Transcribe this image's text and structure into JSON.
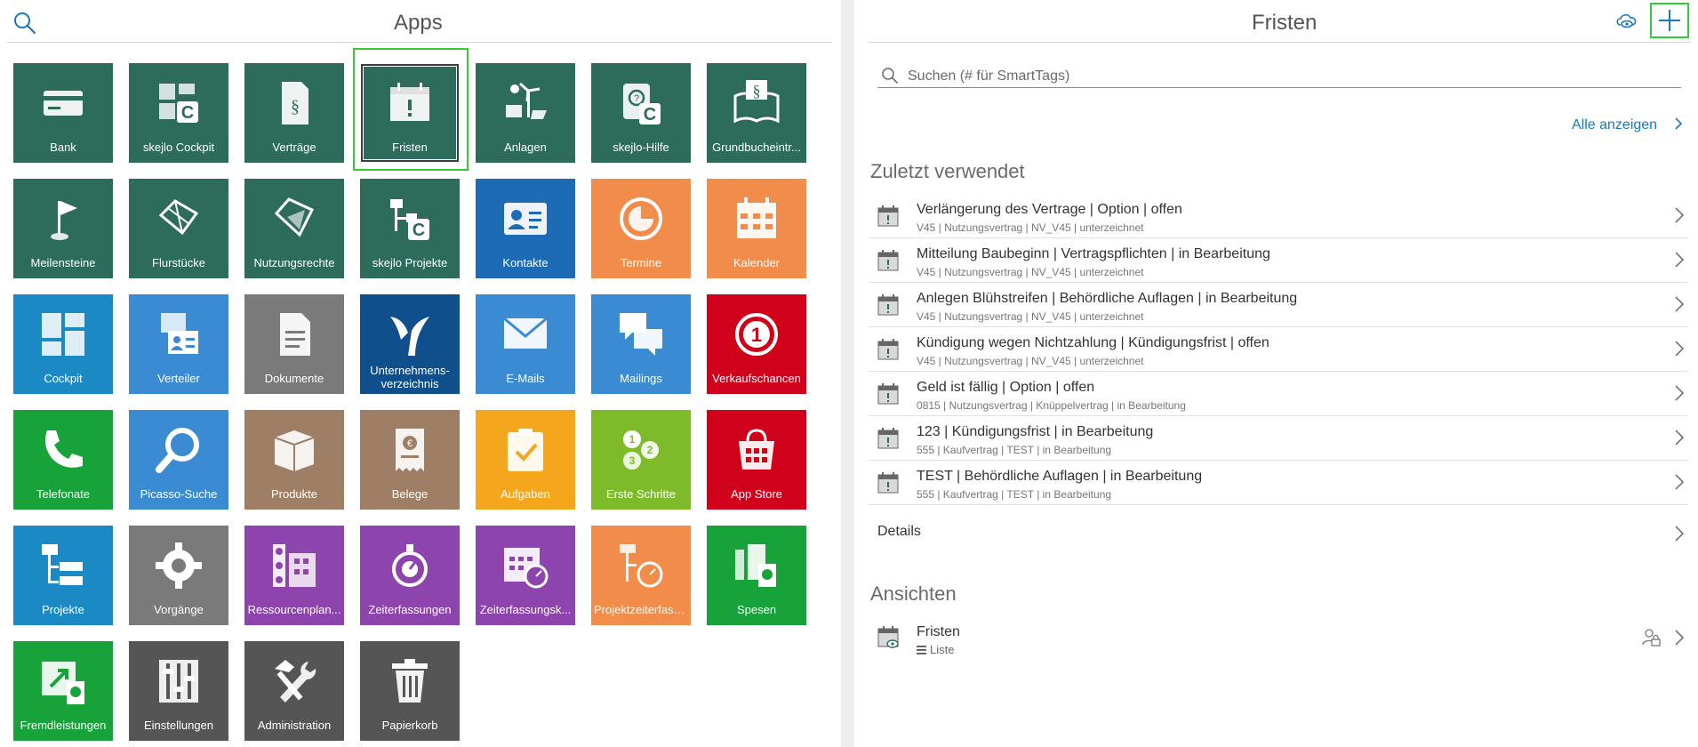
{
  "left_panel": {
    "title": "Apps",
    "search_icon": "search-icon",
    "tiles": [
      {
        "label": "Bank",
        "color": "#2d6b5a",
        "icon": "bank-card-icon"
      },
      {
        "label": "skejlo Cockpit",
        "color": "#2d6b5a",
        "icon": "cockpit-c-icon"
      },
      {
        "label": "Verträge",
        "color": "#2d6b5a",
        "icon": "contract-icon"
      },
      {
        "label": "Fristen",
        "color": "#2d6b5a",
        "icon": "calendar-alert-icon",
        "selected": true
      },
      {
        "label": "Anlagen",
        "color": "#2d6b5a",
        "icon": "power-plant-icon"
      },
      {
        "label": "skejlo-Hilfe",
        "color": "#2d6b5a",
        "icon": "help-book-icon"
      },
      {
        "label": "Grundbucheintr...",
        "color": "#2d6b5a",
        "icon": "law-book-icon"
      },
      {
        "label": "Meilensteine",
        "color": "#2d6b5a",
        "icon": "milestone-flag-icon"
      },
      {
        "label": "Flurstücke",
        "color": "#2d6b5a",
        "icon": "land-parcel-icon"
      },
      {
        "label": "Nutzungsrechte",
        "color": "#2d6b5a",
        "icon": "usage-rights-icon"
      },
      {
        "label": "skejlo Projekte",
        "color": "#2d6b5a",
        "icon": "project-tree-c-icon"
      },
      {
        "label": "Kontakte",
        "color": "#1c6bb4",
        "icon": "contact-card-icon"
      },
      {
        "label": "Termine",
        "color": "#f28c4a",
        "icon": "appointment-clock-icon"
      },
      {
        "label": "Kalender",
        "color": "#f28c4a",
        "icon": "calendar-icon"
      },
      {
        "label": "Cockpit",
        "color": "#1b8ac4",
        "icon": "dashboard-icon"
      },
      {
        "label": "Verteiler",
        "color": "#3a8bd2",
        "icon": "distribution-list-icon"
      },
      {
        "label": "Dokumente",
        "color": "#7a7a7a",
        "icon": "document-icon"
      },
      {
        "label": "Unternehmens- verzeichnis",
        "color": "#0f4f8c",
        "icon": "company-directory-icon",
        "two_lines": true
      },
      {
        "label": "E-Mails",
        "color": "#3a8bd2",
        "icon": "envelope-icon"
      },
      {
        "label": "Mailings",
        "color": "#3a8bd2",
        "icon": "chat-bubbles-icon"
      },
      {
        "label": "Verkaufschancen",
        "color": "#d0021b",
        "icon": "sales-opportunity-icon"
      },
      {
        "label": "Telefonate",
        "color": "#17a33a",
        "icon": "phone-icon"
      },
      {
        "label": "Picasso-Suche",
        "color": "#3a8bd2",
        "icon": "magnifier-icon"
      },
      {
        "label": "Produkte",
        "color": "#9e7f66",
        "icon": "product-box-icon"
      },
      {
        "label": "Belege",
        "color": "#9e7f66",
        "icon": "receipt-icon"
      },
      {
        "label": "Aufgaben",
        "color": "#f4a71c",
        "icon": "task-clipboard-icon"
      },
      {
        "label": "Erste Schritte",
        "color": "#7dbb2a",
        "icon": "first-steps-icon"
      },
      {
        "label": "App Store",
        "color": "#d0021b",
        "icon": "app-store-icon"
      },
      {
        "label": "Projekte",
        "color": "#1b8ac4",
        "icon": "project-tree-icon"
      },
      {
        "label": "Vorgänge",
        "color": "#7a7a7a",
        "icon": "gear-icon"
      },
      {
        "label": "Ressourcenplan...",
        "color": "#8e44ad",
        "icon": "resource-plan-icon"
      },
      {
        "label": "Zeiterfassungen",
        "color": "#8e44ad",
        "icon": "stopwatch-icon"
      },
      {
        "label": "Zeiterfassungsk...",
        "color": "#8e44ad",
        "icon": "time-calendar-icon"
      },
      {
        "label": "Projektzeiterfass...",
        "color": "#f28c4a",
        "icon": "project-time-icon"
      },
      {
        "label": "Spesen",
        "color": "#17a33a",
        "icon": "expenses-icon"
      },
      {
        "label": "Fremdleistungen",
        "color": "#17a33a",
        "icon": "external-services-icon"
      },
      {
        "label": "Einstellungen",
        "color": "#555555",
        "icon": "sliders-icon"
      },
      {
        "label": "Administration",
        "color": "#555555",
        "icon": "tools-icon"
      },
      {
        "label": "Papierkorb",
        "color": "#555555",
        "icon": "trash-icon"
      }
    ]
  },
  "right_panel": {
    "title": "Fristen",
    "accent_color": "#1a78c2",
    "search": {
      "placeholder": "Suchen (# für SmartTags)",
      "value": ""
    },
    "show_all_label": "Alle anzeigen",
    "recent_title": "Zuletzt verwendet",
    "recent_items": [
      {
        "title": "Verlängerung des Vertrage | Option | offen",
        "subtitle": "V45 | Nutzungsvertrag | NV_V45 | unterzeichnet"
      },
      {
        "title": "Mitteilung Baubeginn | Vertragspflichten | in Bearbeitung",
        "subtitle": "V45 | Nutzungsvertrag | NV_V45 | unterzeichnet"
      },
      {
        "title": "Anlegen Blühstreifen | Behördliche Auflagen | in Bearbeitung",
        "subtitle": "V45 | Nutzungsvertrag | NV_V45 | unterzeichnet"
      },
      {
        "title": "Kündigung wegen Nichtzahlung | Kündigungsfrist | offen",
        "subtitle": "V45 | Nutzungsvertrag | NV_V45 | unterzeichnet"
      },
      {
        "title": "Geld ist fällig | Option | offen",
        "subtitle": "0815 | Nutzungsvertrag | Knüppelvertrag | in Bearbeitung"
      },
      {
        "title": "123 | Kündigungsfrist | in Bearbeitung",
        "subtitle": "555 | Kaufvertrag | TEST | in Bearbeitung"
      },
      {
        "title": "TEST | Behördliche Auflagen | in Bearbeitung",
        "subtitle": "555 | Kaufvertrag | TEST | in Bearbeitung"
      }
    ],
    "details_label": "Details",
    "views_title": "Ansichten",
    "views": [
      {
        "title": "Fristen",
        "subtitle": "Liste"
      }
    ]
  }
}
